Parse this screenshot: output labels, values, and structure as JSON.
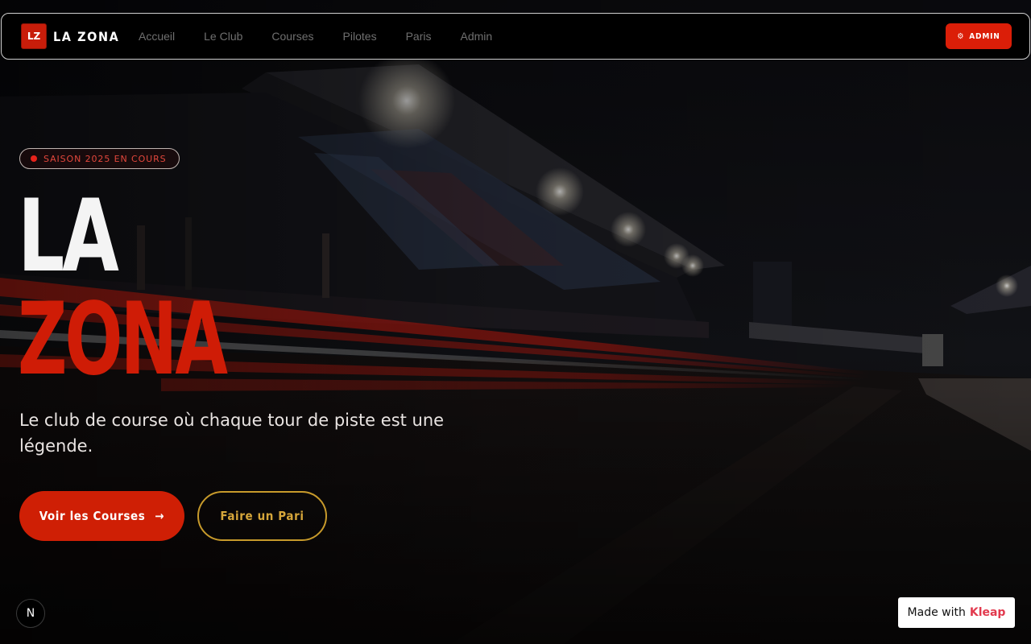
{
  "colors": {
    "accent_red": "#cf1c06",
    "gold": "#d6a63a",
    "background": "#07070a"
  },
  "nav": {
    "logo_mark": "LZ",
    "logo_text": "LA ZONA",
    "links": [
      "Accueil",
      "Le Club",
      "Courses",
      "Pilotes",
      "Paris",
      "Admin"
    ],
    "admin_icon": "gear-icon",
    "admin_label": "ADMIN"
  },
  "hero": {
    "badge": "SAISON 2025 EN COURS",
    "title_line1": "LA",
    "title_line2": "ZONA",
    "subtitle": "Le club de course où chaque tour de piste est une légende.",
    "primary_cta": "Voir les Courses",
    "primary_cta_icon": "arrow-right-icon",
    "secondary_cta": "Faire un Pari"
  },
  "widgets": {
    "next_badge": "N",
    "made_with_prefix": "Made with",
    "made_with_brand": "Kleap"
  }
}
